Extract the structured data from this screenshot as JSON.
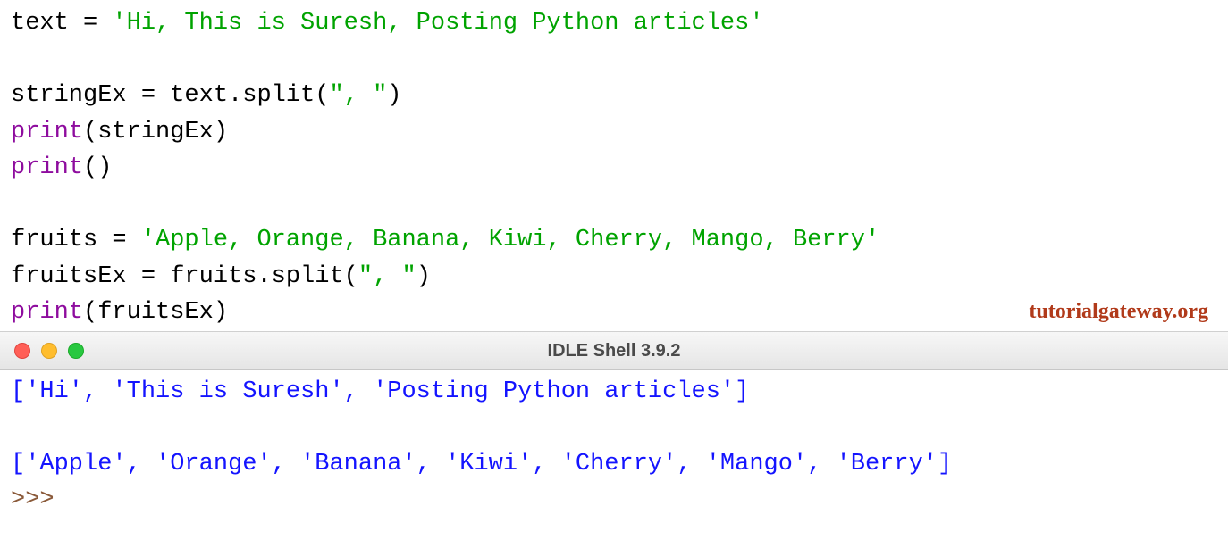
{
  "editor": {
    "l1_var": "text",
    "l1_eq": " = ",
    "l1_str": "'Hi, This is Suresh, Posting Python articles'",
    "l2_var": "stringEx",
    "l2_eq": " = text.split(",
    "l2_arg": "\", \"",
    "l2_close": ")",
    "l3_print": "print",
    "l3_rest": "(stringEx)",
    "l4_print": "print",
    "l4_rest": "()",
    "l5_var": "fruits",
    "l5_eq": " = ",
    "l5_str": "'Apple, Orange, Banana, Kiwi, Cherry, Mango, Berry'",
    "l6_var": "fruitsEx",
    "l6_eq": " = fruits.split(",
    "l6_arg": "\", \"",
    "l6_close": ")",
    "l7_print": "print",
    "l7_rest": "(fruitsEx)"
  },
  "watermark": "tutorialgateway.org",
  "window": {
    "title": "IDLE Shell 3.9.2"
  },
  "shell": {
    "out1": "['Hi', 'This is Suresh', 'Posting Python articles']",
    "out2": "['Apple', 'Orange', 'Banana', 'Kiwi', 'Cherry', 'Mango', 'Berry']",
    "prompt": ">>> "
  },
  "colors": {
    "string": "#00a300",
    "builtin": "#8e0c9e",
    "output": "#1414ff",
    "prompt": "#8a5a3a",
    "default": "#000000",
    "watermark": "#b13a1a"
  }
}
